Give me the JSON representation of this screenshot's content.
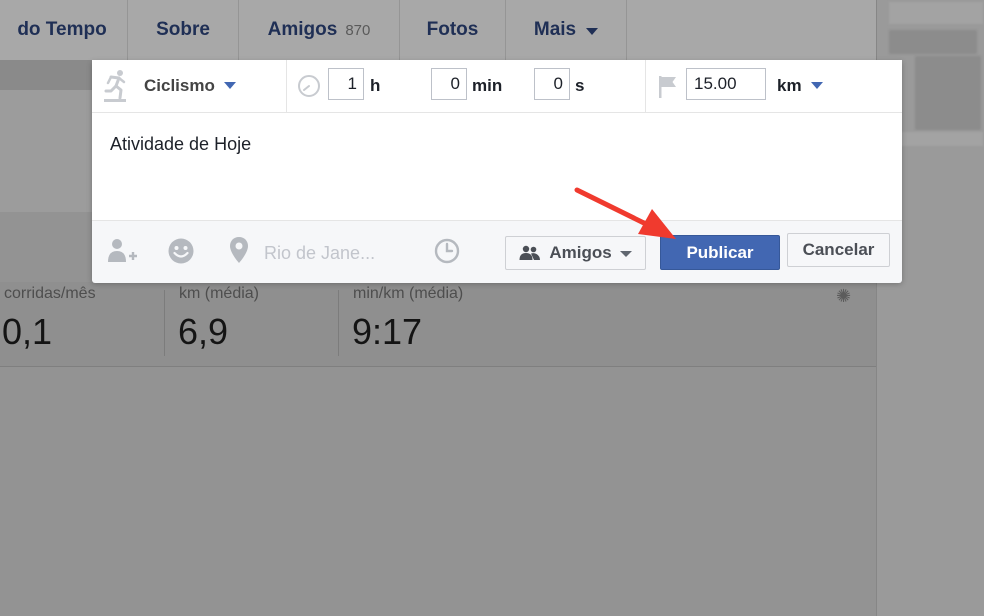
{
  "nav": {
    "items": [
      {
        "label": "do Tempo"
      },
      {
        "label": "Sobre"
      },
      {
        "label": "Amigos",
        "count": "870"
      },
      {
        "label": "Fotos"
      },
      {
        "label": "Mais"
      }
    ]
  },
  "stats": {
    "items": [
      {
        "label": "corridas/mês",
        "value": "0,1"
      },
      {
        "label": "km (média)",
        "value": "6,9"
      },
      {
        "label": "min/km (média)",
        "value": "9:17"
      }
    ],
    "settings_icon": "gear-icon"
  },
  "composer": {
    "activity": {
      "label": "Ciclismo",
      "icon": "runner-icon"
    },
    "duration": {
      "icon": "stopwatch-icon",
      "hours": "1",
      "hours_unit": "h",
      "minutes": "0",
      "minutes_unit": "min",
      "seconds": "0",
      "seconds_unit": "s"
    },
    "distance": {
      "icon": "flag-icon",
      "value": "15.00",
      "unit": "km"
    },
    "text": "Atividade de Hoje",
    "footer": {
      "tag_friends_icon": "tag-friends-icon",
      "feeling_icon": "smiley-icon",
      "location_icon": "location-pin-icon",
      "location_placeholder": "Rio de Jane...",
      "schedule_icon": "clock-icon",
      "audience_label": "Amigos",
      "audience_icon": "friends-icon",
      "publish_label": "Publicar",
      "cancel_label": "Cancelar"
    }
  },
  "colors": {
    "primary": "#4267b2",
    "annotation_arrow": "#f03a2e",
    "overlay": "#8f8f8f"
  }
}
